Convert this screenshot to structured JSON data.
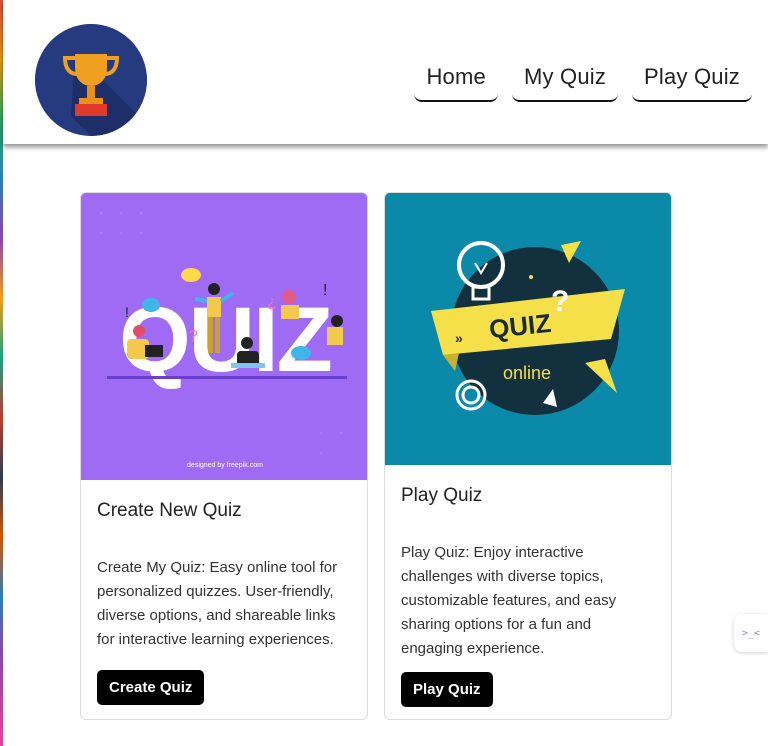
{
  "nav": {
    "links": [
      "Home",
      "My Quiz",
      "Play Quiz"
    ]
  },
  "logo": {
    "icon": "trophy-icon"
  },
  "cards": [
    {
      "title": "Create New Quiz",
      "text": "Create My Quiz: Easy online tool for personalized quizzes. User-friendly, diverse options, and shareable links for interactive learning experiences.",
      "button": "Create Quiz",
      "image": {
        "word": "QUIZ",
        "credit": "designed by freepik.com",
        "bg": "#9f6bf4"
      }
    },
    {
      "title": "Play Quiz",
      "text": "Play Quiz: Enjoy interactive challenges with diverse topics, customizable features, and easy sharing options for a fun and engaging experience.",
      "button": "Play Quiz",
      "image": {
        "word1": "QUIZ",
        "word2": "online",
        "bg": "#0a8aa8"
      }
    }
  ],
  "widget": {
    "glyph": ">_<"
  },
  "colors": {
    "accent": "#000000",
    "logo_bg": "#263a80",
    "trophy": "#f0a020"
  }
}
